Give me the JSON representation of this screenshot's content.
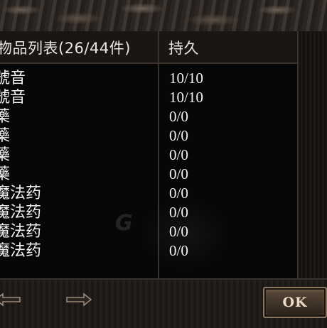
{
  "header": {
    "item_list_label": "物品列表(26/44件)",
    "durability_label": "持久"
  },
  "items": [
    {
      "name": "號音",
      "durability": "10/10"
    },
    {
      "name": "號音",
      "durability": "10/10"
    },
    {
      "name": "藥",
      "durability": "0/0"
    },
    {
      "name": "藥",
      "durability": "0/0"
    },
    {
      "name": "藥",
      "durability": "0/0"
    },
    {
      "name": "藥",
      "durability": "0/0"
    },
    {
      "name": "魔法药",
      "durability": "0/0"
    },
    {
      "name": "魔法药",
      "durability": "0/0"
    },
    {
      "name": "魔法药",
      "durability": "0/0"
    },
    {
      "name": "魔法药",
      "durability": "0/0"
    }
  ],
  "footer": {
    "prev_icon": "arrow-left-icon",
    "next_icon": "arrow-right-icon",
    "ok_label": "OK"
  }
}
